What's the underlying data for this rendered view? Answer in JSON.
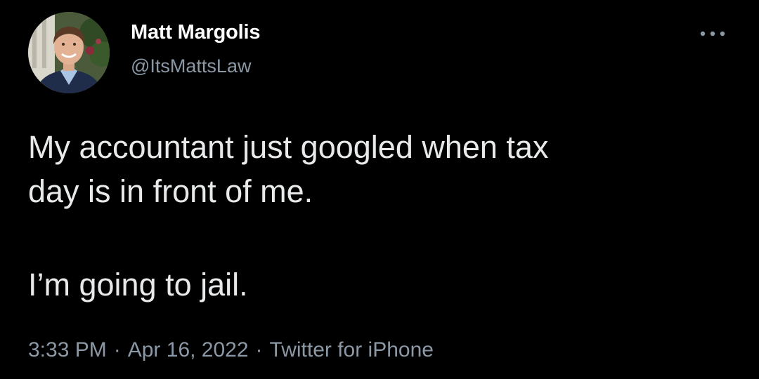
{
  "author": {
    "display_name": "Matt Margolis",
    "handle": "@ItsMattsLaw",
    "avatar_icon": "profile-photo"
  },
  "more_icon": "more-horizontal-icon",
  "tweet": {
    "lines": [
      "My accountant just googled when tax",
      "day is in front of me.",
      "I’m going to jail."
    ]
  },
  "meta": {
    "time": "3:33 PM",
    "date": "Apr 16, 2022",
    "source": "Twitter for iPhone",
    "separator": "·"
  },
  "colors": {
    "background": "#000000",
    "name": "#ffffff",
    "body_text": "#e7e9ea",
    "secondary_text": "#8b98a5"
  }
}
